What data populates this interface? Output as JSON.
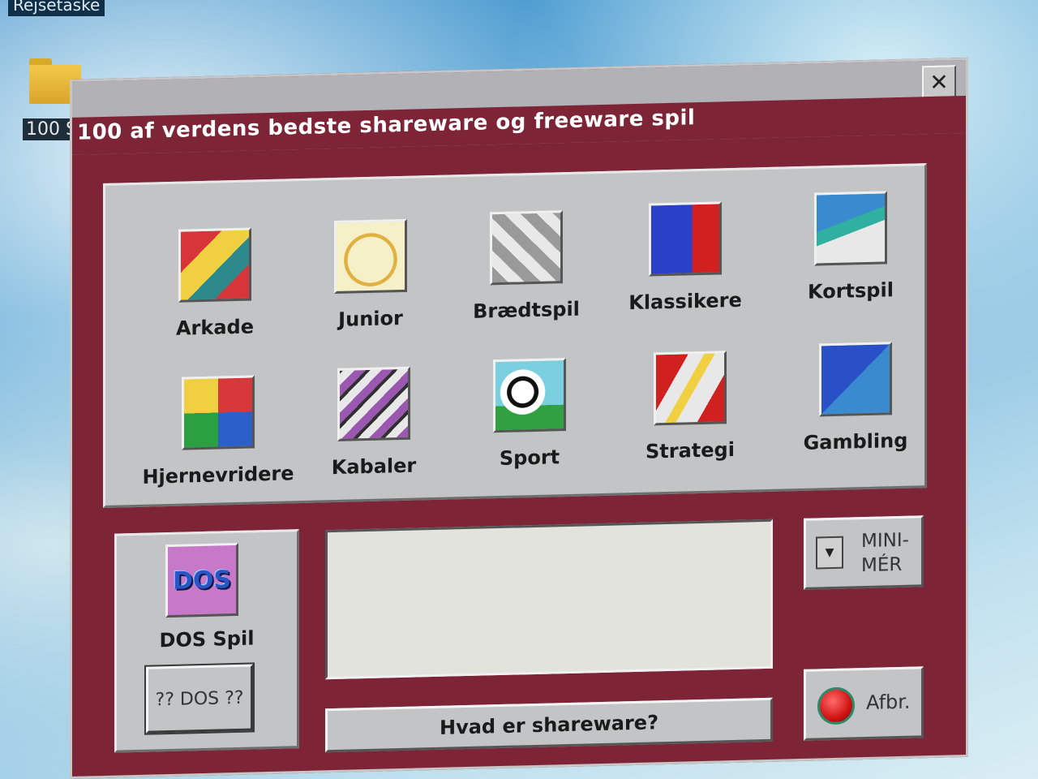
{
  "desktop": {
    "top_label": "Rejsetaske",
    "folder_label": "100 S"
  },
  "window": {
    "title": "100 af verdens bedste shareware og freeware spil",
    "close_label": "✕"
  },
  "games": [
    {
      "label": "Arkade",
      "icon": "arcade-hand-icon",
      "colors": [
        "#d8353a",
        "#f0d040",
        "#2c8a8c"
      ]
    },
    {
      "label": "Junior",
      "icon": "junior-face-icon",
      "colors": [
        "#f6f0c8",
        "#e0b040",
        "#c03020"
      ]
    },
    {
      "label": "Brædtspil",
      "icon": "chess-piece-icon",
      "colors": [
        "#9a9a9a",
        "#e8e8e8",
        "#101010"
      ]
    },
    {
      "label": "Klassikere",
      "icon": "classics-dice-icon",
      "colors": [
        "#2a40c8",
        "#d02020",
        "#e0e0e0"
      ]
    },
    {
      "label": "Kortspil",
      "icon": "cards-icon",
      "colors": [
        "#3a8ad0",
        "#30b0a0",
        "#e8e8e8"
      ]
    },
    {
      "label": "Hjernevridere",
      "icon": "puzzle-icon",
      "colors": [
        "#d8383a",
        "#f0d040",
        "#2a60c8"
      ]
    },
    {
      "label": "Kabaler",
      "icon": "solitaire-icon",
      "colors": [
        "#9a58b0",
        "#e8e8e8",
        "#303030"
      ]
    },
    {
      "label": "Sport",
      "icon": "soccer-ball-icon",
      "colors": [
        "#7ad0e0",
        "#30a040",
        "#ffffff"
      ]
    },
    {
      "label": "Strategi",
      "icon": "strategy-lightning-icon",
      "colors": [
        "#d02020",
        "#f0d040",
        "#e8e8e8"
      ]
    },
    {
      "label": "Gambling",
      "icon": "gambling-dice-icon",
      "colors": [
        "#2a50c8",
        "#3a8ad0",
        "#ffffff"
      ]
    }
  ],
  "dos": {
    "icon_text": "DOS",
    "label": "DOS Spil",
    "button": "?? DOS ??"
  },
  "shareware_button": "Hvad er shareware?",
  "minimize": {
    "line1": "MINI-",
    "line2": "MÉR",
    "arrow": "▼"
  },
  "cancel_button": "Afbr."
}
